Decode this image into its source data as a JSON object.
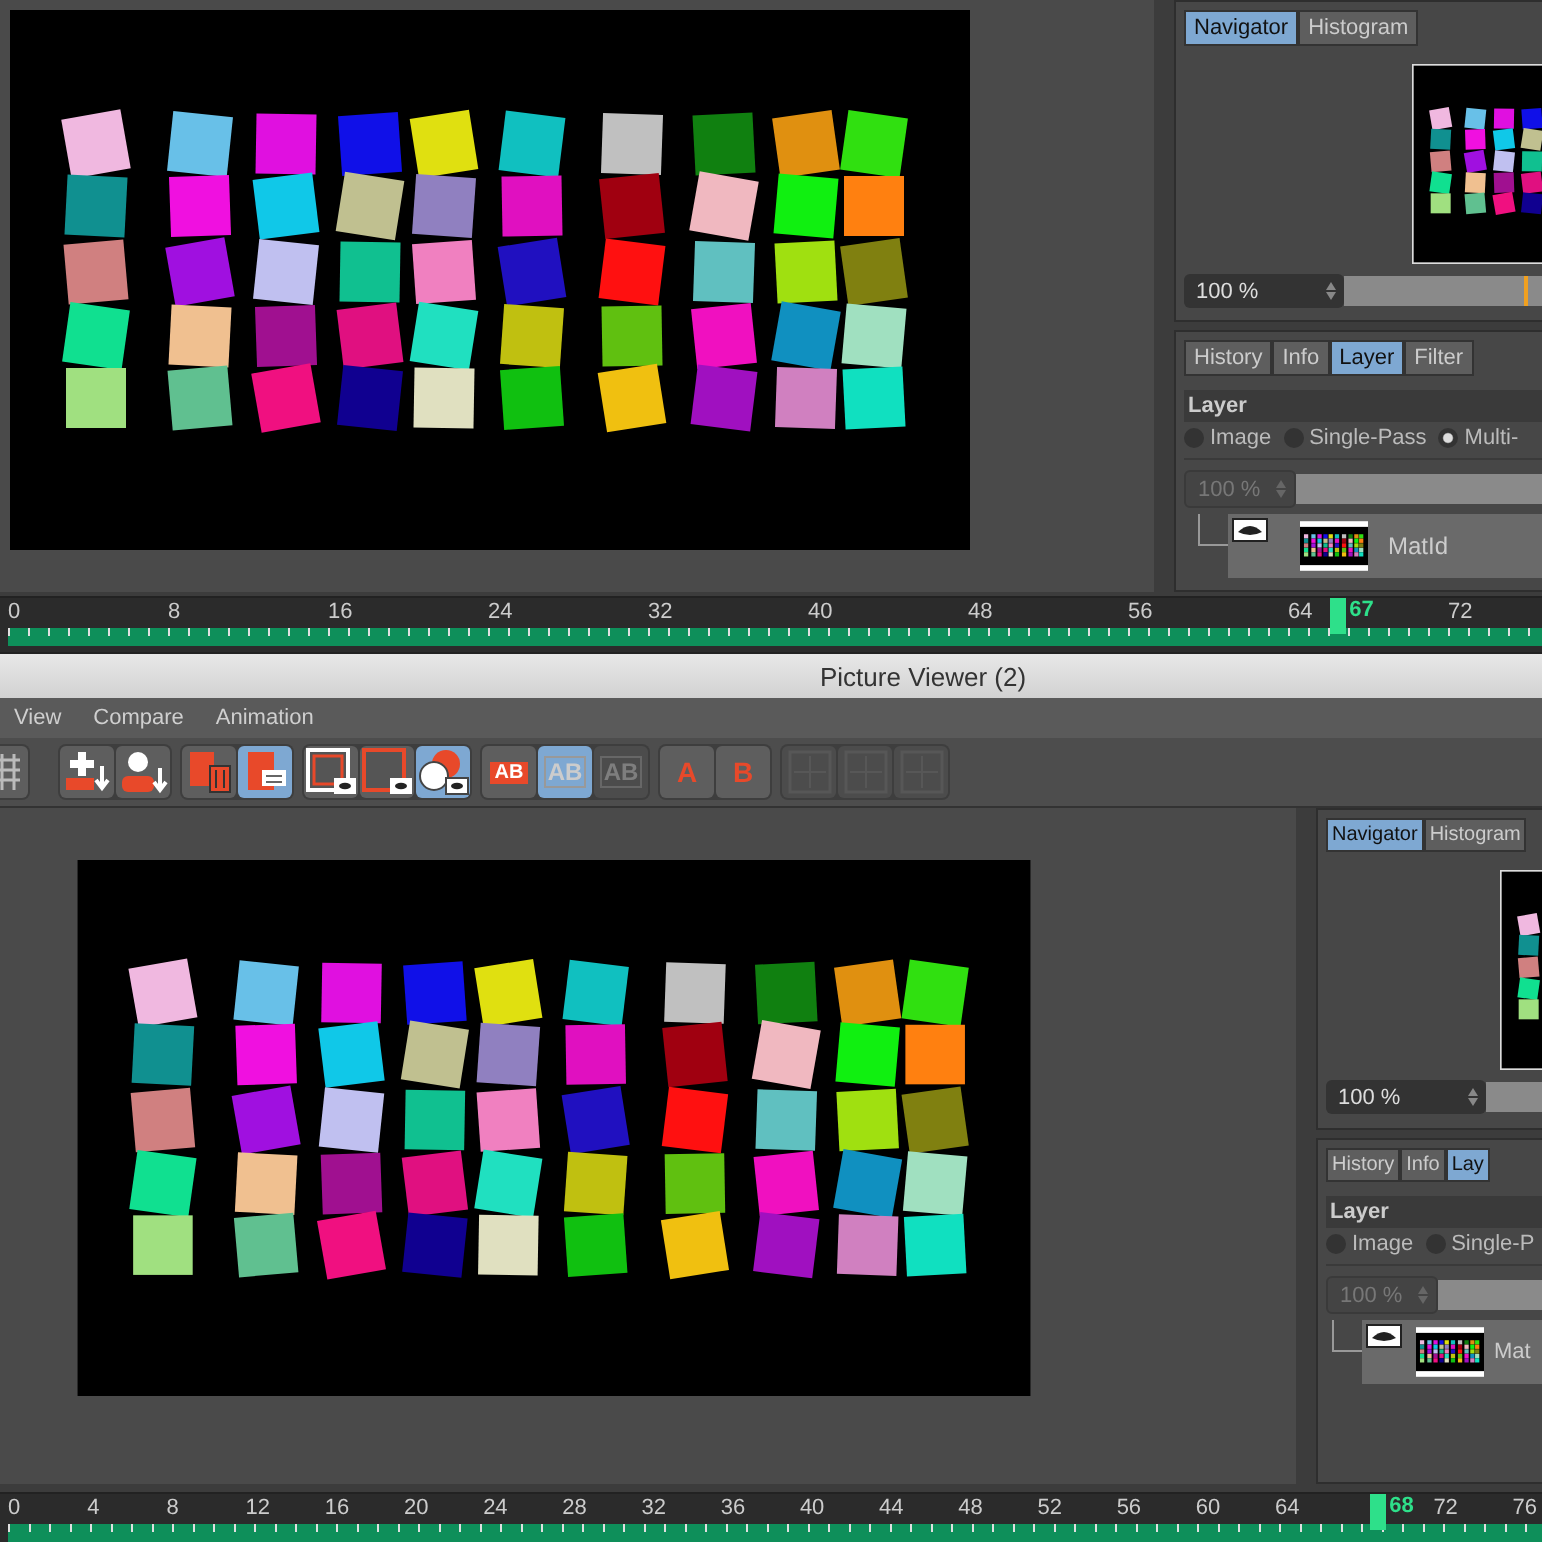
{
  "upper_window": {
    "navigator": {
      "tabs": [
        {
          "label": "Navigator",
          "selected": true
        },
        {
          "label": "Histogram",
          "selected": false
        }
      ],
      "zoom": "100 %",
      "level": 0.45
    },
    "layer_panel": {
      "tabs": [
        {
          "label": "History",
          "selected": false
        },
        {
          "label": "Info",
          "selected": false
        },
        {
          "label": "Layer",
          "selected": true
        },
        {
          "label": "Filter",
          "selected": false
        }
      ],
      "heading": "Layer",
      "modes": [
        {
          "label": "Image",
          "selected": false
        },
        {
          "label": "Single-Pass",
          "selected": false
        },
        {
          "label": "Multi-",
          "selected": true
        }
      ],
      "opacity": "100 %",
      "layers": [
        {
          "name": "MatId",
          "visible": true
        }
      ]
    },
    "timeline": {
      "labels": [
        "0",
        "8",
        "16",
        "24",
        "32",
        "40",
        "48",
        "56",
        "64",
        "72"
      ],
      "current_frame": "67",
      "level": 0.862
    }
  },
  "picture_viewer": {
    "title": "Picture Viewer (2)",
    "menu": [
      "View",
      "Compare",
      "Animation"
    ],
    "toolbar": [
      [
        {
          "kind": "grid",
          "selected": false,
          "disabled": false
        }
      ],
      [
        {
          "kind": "add-frame",
          "selected": false,
          "disabled": false
        },
        {
          "kind": "user-down",
          "selected": false,
          "disabled": false
        }
      ],
      [
        {
          "kind": "delete",
          "selected": false,
          "disabled": false
        },
        {
          "kind": "save",
          "selected": true,
          "disabled": false
        }
      ],
      [
        {
          "kind": "frame-a",
          "selected": false,
          "disabled": false
        },
        {
          "kind": "frame-b",
          "selected": false,
          "disabled": false
        },
        {
          "kind": "overlap",
          "selected": true,
          "disabled": false
        }
      ],
      [
        {
          "kind": "ab-split",
          "label": "AB",
          "selected": false,
          "disabled": false
        },
        {
          "kind": "ab-swap",
          "label": "AB",
          "selected": true,
          "disabled": false
        },
        {
          "kind": "ab-swap",
          "label": "AB",
          "selected": false,
          "disabled": true
        }
      ],
      [
        {
          "kind": "set",
          "label": "A",
          "selected": false,
          "disabled": false
        },
        {
          "kind": "set",
          "label": "B",
          "selected": false,
          "disabled": false
        }
      ],
      [
        {
          "kind": "layout",
          "selected": false,
          "disabled": true
        },
        {
          "kind": "layout",
          "selected": false,
          "disabled": true
        },
        {
          "kind": "layout",
          "selected": false,
          "disabled": true
        }
      ]
    ],
    "navigator": {
      "tabs": [
        {
          "label": "Navigator",
          "selected": true
        },
        {
          "label": "Histogram",
          "selected": false
        }
      ],
      "zoom": "100 %"
    },
    "layer_panel": {
      "tabs": [
        {
          "label": "History",
          "selected": false
        },
        {
          "label": "Info",
          "selected": false
        },
        {
          "label": "Lay",
          "selected": true
        }
      ],
      "heading": "Layer",
      "modes": [
        {
          "label": "Image",
          "selected": false
        },
        {
          "label": "Single-P",
          "selected": false
        }
      ],
      "opacity": "100 %",
      "layers": [
        {
          "name": "Mat",
          "visible": true
        }
      ]
    },
    "timeline": {
      "labels": [
        "0",
        "4",
        "8",
        "12",
        "16",
        "20",
        "24",
        "28",
        "32",
        "36",
        "40",
        "44",
        "48",
        "52",
        "56",
        "60",
        "64",
        "72",
        "76"
      ],
      "current_frame": "68",
      "level": 0.888
    }
  }
}
